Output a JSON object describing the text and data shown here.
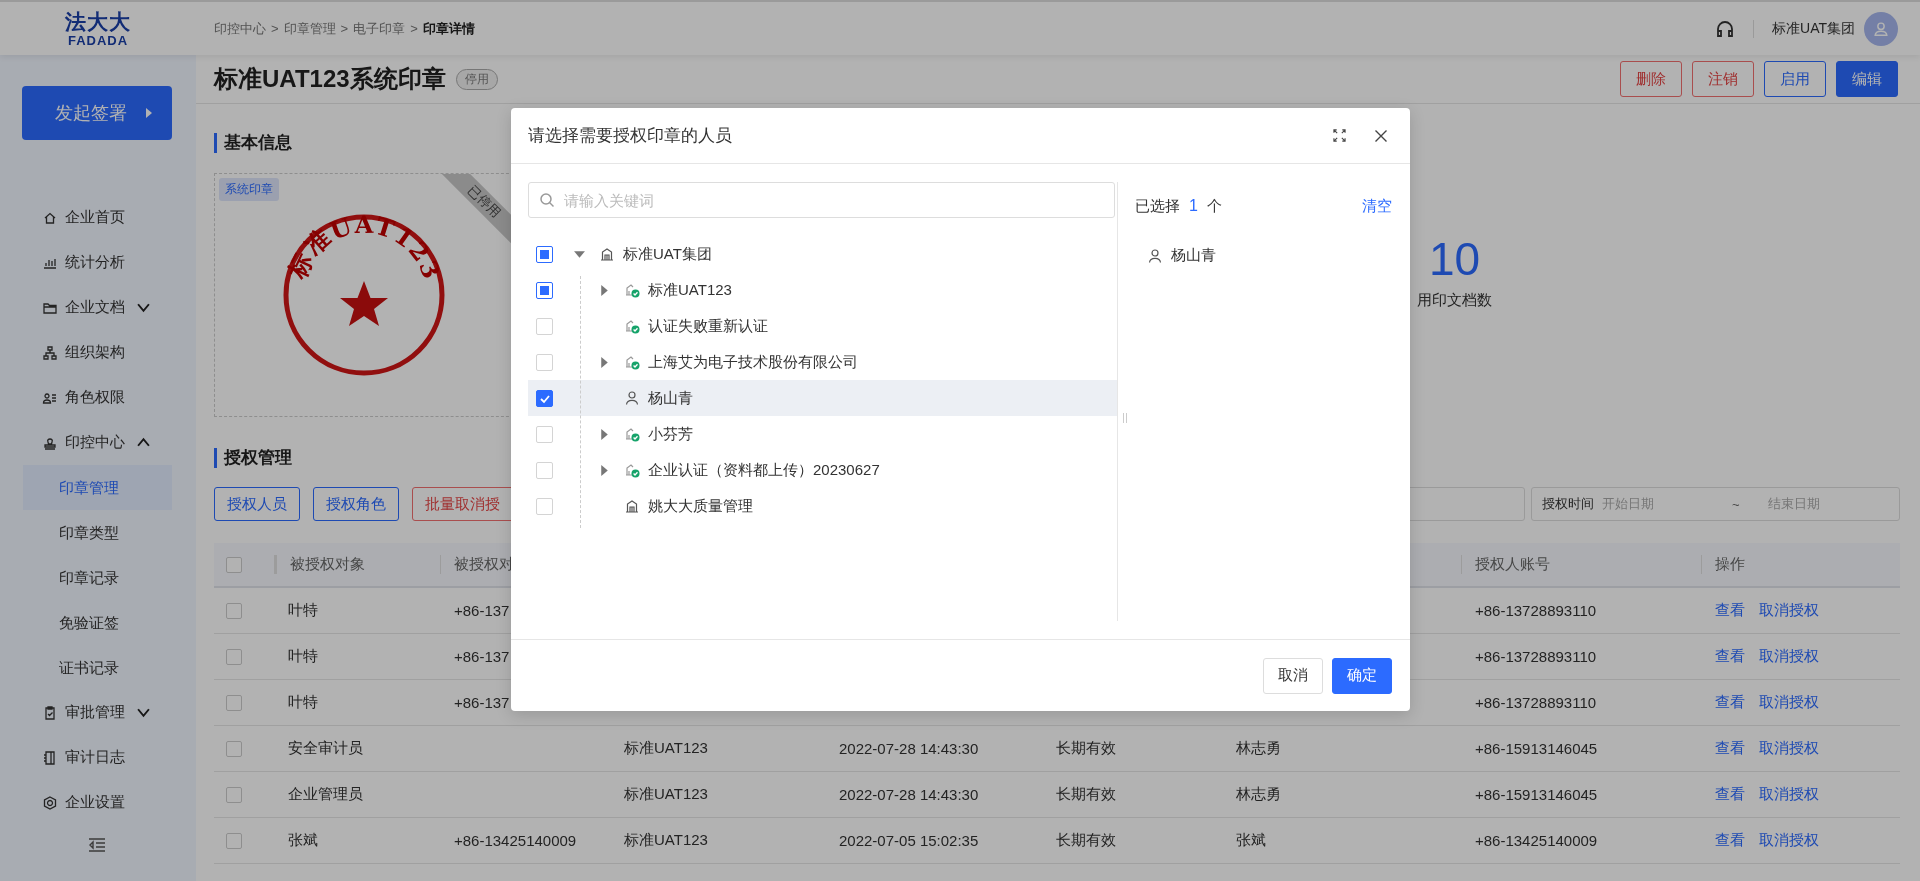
{
  "header": {
    "logo": {
      "title": "法大大",
      "subtitle": "FADADA"
    },
    "breadcrumb": {
      "separator": ">",
      "items": [
        "印控中心",
        "印章管理",
        "电子印章",
        "印章详情"
      ]
    },
    "account": "标准UAT集团"
  },
  "sidebar": {
    "start_button": "发起签署",
    "items": [
      {
        "label": "企业首页",
        "selected": false
      },
      {
        "label": "统计分析",
        "selected": false
      },
      {
        "label": "企业文档",
        "selected": false,
        "expanded": false
      },
      {
        "label": "组织架构",
        "selected": false
      },
      {
        "label": "角色权限",
        "selected": false
      },
      {
        "label": "印控中心",
        "selected": false,
        "expanded": true,
        "children": [
          {
            "label": "印章管理",
            "selected": true
          },
          {
            "label": "印章类型",
            "selected": false
          },
          {
            "label": "印章记录",
            "selected": false
          },
          {
            "label": "免验证签",
            "selected": false
          },
          {
            "label": "证书记录",
            "selected": false
          }
        ]
      },
      {
        "label": "审批管理",
        "selected": false,
        "expanded": false
      },
      {
        "label": "审计日志",
        "selected": false
      },
      {
        "label": "企业设置",
        "selected": false
      }
    ]
  },
  "page": {
    "title": "标准UAT123系统印章",
    "status": "停用",
    "actions": [
      {
        "label": "删除",
        "kind": "danger"
      },
      {
        "label": "注销",
        "kind": "danger"
      },
      {
        "label": "启用",
        "kind": "default"
      },
      {
        "label": "编辑",
        "kind": "primary"
      }
    ]
  },
  "basic_info": {
    "heading": "基本信息",
    "seal": {
      "tag": "系统印章",
      "ribbon": "已停用",
      "text": "标准UAT123"
    },
    "stat": {
      "value": "10",
      "label": "用印文档数"
    }
  },
  "authorization": {
    "heading": "授权管理",
    "buttons": [
      {
        "label": "授权人员",
        "kind": "default"
      },
      {
        "label": "授权角色",
        "kind": "default"
      },
      {
        "label": "批量取消授",
        "kind": "danger"
      }
    ],
    "date_filter": {
      "label": "授权时间",
      "start_placeholder": "开始日期",
      "separator": "~",
      "end_placeholder": "结束日期"
    },
    "table": {
      "header_checked": false,
      "columns": [
        "被授权对象",
        "被授权对",
        null,
        null,
        null,
        null,
        "授权人账号",
        "操作"
      ],
      "rows": [
        {
          "checked": false,
          "cells": [
            "叶特",
            "+86-137",
            null,
            null,
            null,
            null,
            "+86-13728893110"
          ],
          "actions": [
            "查看",
            "取消授权"
          ]
        },
        {
          "checked": false,
          "cells": [
            "叶特",
            "+86-137",
            null,
            null,
            null,
            null,
            "+86-13728893110"
          ],
          "actions": [
            "查看",
            "取消授权"
          ]
        },
        {
          "checked": false,
          "cells": [
            "叶特",
            "+86-137",
            null,
            null,
            null,
            null,
            "+86-13728893110"
          ],
          "actions": [
            "查看",
            "取消授权"
          ]
        },
        {
          "checked": false,
          "cells": [
            "安全审计员",
            null,
            "标准UAT123",
            "2022-07-28 14:43:30",
            "长期有效",
            "林志勇",
            "+86-15913146045"
          ],
          "actions": [
            "查看",
            "取消授权"
          ]
        },
        {
          "checked": false,
          "cells": [
            "企业管理员",
            null,
            "标准UAT123",
            "2022-07-28 14:43:30",
            "长期有效",
            "林志勇",
            "+86-15913146045"
          ],
          "actions": [
            "查看",
            "取消授权"
          ]
        },
        {
          "checked": false,
          "cells": [
            "张斌",
            "+86-13425140009",
            "标准UAT123",
            "2022-07-05 15:02:35",
            "长期有效",
            "张斌",
            "+86-13425140009"
          ],
          "actions": [
            "查看",
            "取消授权"
          ]
        }
      ]
    }
  },
  "dialog": {
    "title": "请选择需要授权印章的人员",
    "search": {
      "placeholder": "请输入关键词"
    },
    "tree": [
      {
        "label": "标准UAT集团",
        "kind": "org",
        "checked": false,
        "indeterminate": true,
        "selected": false,
        "expanded": true,
        "children": [
          {
            "label": "标准UAT123",
            "kind": "verified_org",
            "checked": false,
            "indeterminate": true,
            "selected": false,
            "expanded": false
          },
          {
            "label": "认证失败重新认证",
            "kind": "verified_org",
            "checked": false,
            "indeterminate": false,
            "selected": false
          },
          {
            "label": "上海艾为电子技术股份有限公司",
            "kind": "verified_org",
            "checked": false,
            "indeterminate": false,
            "selected": false,
            "expanded": false
          },
          {
            "label": "杨山青",
            "kind": "person",
            "checked": true,
            "indeterminate": false,
            "selected": true
          },
          {
            "label": "小芬芳",
            "kind": "verified_org",
            "checked": false,
            "indeterminate": false,
            "selected": false,
            "expanded": false
          },
          {
            "label": "企业认证（资料都上传）20230627",
            "kind": "verified_org",
            "checked": false,
            "indeterminate": false,
            "selected": false,
            "expanded": false
          },
          {
            "label": "姚大大质量管理",
            "kind": "org",
            "checked": false,
            "indeterminate": false,
            "selected": false
          }
        ]
      }
    ],
    "selected_summary": {
      "prefix": "已选择",
      "count": "1",
      "suffix": "个",
      "clear": "清空"
    },
    "selected_people": [
      "杨山青"
    ],
    "buttons": [
      {
        "label": "取消",
        "kind": "default"
      },
      {
        "label": "确定",
        "kind": "primary"
      }
    ]
  }
}
